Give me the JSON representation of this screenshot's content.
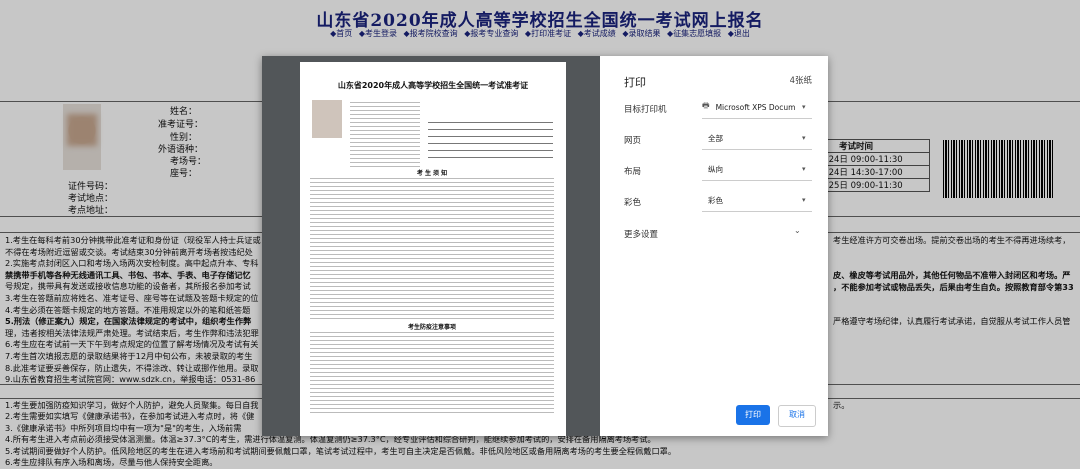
{
  "site": {
    "title": "山东省2020年成人高等学校招生全国统一考试网上报名",
    "nav": [
      "首页",
      "考生登录",
      "报考院校查询",
      "报考专业查询",
      "打印准考证",
      "考试成绩",
      "录取结果",
      "征集志愿填报",
      "退出"
    ]
  },
  "card": {
    "labels": [
      "姓名：",
      "准考证号：",
      "性别：",
      "外语语种：",
      "考场号：",
      "座号：",
      "证件号码：",
      "考试地点：",
      "考点地址："
    ],
    "time_table": {
      "header": "考试时间",
      "rows": [
        "10月24日 09:00-11:30",
        "10月24日 14:30-17:00",
        "10月25日 09:00-11:30"
      ]
    }
  },
  "notice_left": [
    "1.考生在每科考前30分钟携带此准考证和身份证（现役军人持士兵证或",
    "不得在考场附近逗留或交谈。考试结束30分钟前离开考场者按违纪处",
    "2.实施考点封闭区入口和考场入场两次安检制度。高中起点升本、专科",
    "禁携带手机等各种无线通讯工具、书包、书本、手表、电子存储记忆",
    "号规定，携带具有发送或接收信息功能的设备者，其所报名参加考试",
    "3.考生在答题前应将姓名、准考证号、座号等在试题及答题卡规定的位",
    "4.考生必须在答题卡规定的地方答题。不准用规定以外的笔和纸答题",
    "5.刑法（修正案九）规定，在国家法律规定的考试中，组织考生作弊",
    "理，违者按相关法律法规严肃处理。考试结束后，考生作弊和违法犯罪",
    "6.考生应在考试前一天下午到考点规定的位置了解考场情况及考试有关",
    "7.考生首次填报志愿的录取结果将于12月中旬公布，未被录取的考生",
    "8.此准考证要妥善保存，防止遗失，不得涂改、转让或挪作他用。录取",
    "9.山东省教育招生考试院官网：www.sdzk.cn，举报电话：0531-86"
  ],
  "notice_right": [
    "考生经准许方可交卷出场。提前交卷出场的考生不得再进场续考，",
    "皮、橡皮等考试用品外，其他任何物品不准带入封闭区和考场。严",
    "，不能参加考试或物品丢失，后果由考生自负。按照教育部令第33",
    "严格遵守考场纪律，认真履行考试承诺，自觉服从考试工作人员管"
  ],
  "health_left": [
    "1.考生要加强防疫知识学习，做好个人防护，避免人员聚集。每日自我",
    "2.考生需要如实填写《健康承诺书》，在参加考试进入考点时，将《健",
    "3.《健康承诺书》中所列项目均中有一项为\"是\"的考生，入场前需"
  ],
  "health_full": [
    "4.所有考生进入考点前必须接受体温测量。体温≥37.3°C的考生，需进行体温复测。体温复测仍≥37.3°C，经专业评估和综合研判，能继续参加考试的，安排在备用隔离考场考试。",
    "5.考试期间要做好个人防护。低风险地区的考生在进入考场前和考试期间要佩戴口罩，笔试考试过程中，考生可自主决定是否佩戴。非低风险地区或备用隔离考场的考生要全程佩戴口罩。",
    "6.考生应排队有序入场和离场，尽量与他人保持安全距离。"
  ],
  "health_right": "示。",
  "dialog": {
    "preview_title": "山东省2020年成人高等学校招生全国统一考试准考证",
    "preview_sections": [
      "考 生 须 知",
      "考生防疫注意事项"
    ],
    "print_title": "打印",
    "sheet_count": "4张纸",
    "rows": [
      {
        "label": "目标打印机",
        "value": "Microsoft XPS Docum"
      },
      {
        "label": "网页",
        "value": "全部"
      },
      {
        "label": "布局",
        "value": "纵向"
      },
      {
        "label": "彩色",
        "value": "彩色"
      }
    ],
    "more_settings": "更多设置",
    "print_button": "打印",
    "cancel_button": "取消"
  }
}
